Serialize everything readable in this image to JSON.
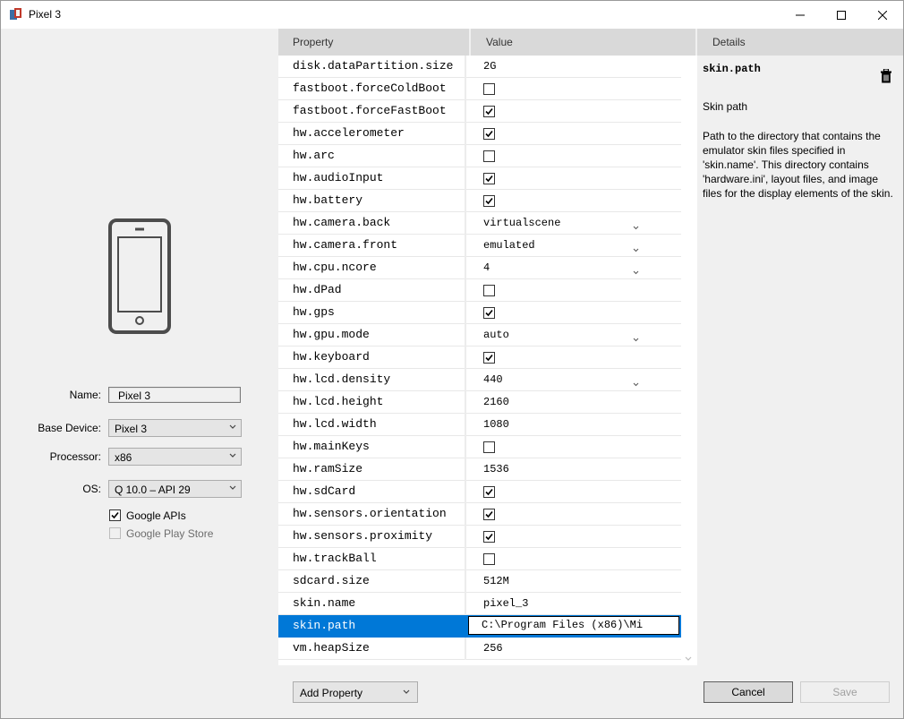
{
  "window": {
    "title": "Pixel 3"
  },
  "form": {
    "name_label": "Name:",
    "name_value": "Pixel 3",
    "base_device_label": "Base Device:",
    "base_device_value": "Pixel 3",
    "processor_label": "Processor:",
    "processor_value": "x86",
    "os_label": "OS:",
    "os_value": "Q 10.0 – API 29",
    "google_apis_label": "Google APIs",
    "google_apis_checked": true,
    "google_play_label": "Google Play Store",
    "google_play_checked": false
  },
  "grid": {
    "header_property": "Property",
    "header_value": "Value",
    "rows": [
      {
        "name": "disk.dataPartition.size",
        "kind": "text",
        "value": "2G"
      },
      {
        "name": "fastboot.forceColdBoot",
        "kind": "check",
        "checked": false
      },
      {
        "name": "fastboot.forceFastBoot",
        "kind": "check",
        "checked": true
      },
      {
        "name": "hw.accelerometer",
        "kind": "check",
        "checked": true
      },
      {
        "name": "hw.arc",
        "kind": "check",
        "checked": false
      },
      {
        "name": "hw.audioInput",
        "kind": "check",
        "checked": true
      },
      {
        "name": "hw.battery",
        "kind": "check",
        "checked": true
      },
      {
        "name": "hw.camera.back",
        "kind": "dropdown",
        "value": "virtualscene"
      },
      {
        "name": "hw.camera.front",
        "kind": "dropdown",
        "value": "emulated"
      },
      {
        "name": "hw.cpu.ncore",
        "kind": "dropdown",
        "value": "4"
      },
      {
        "name": "hw.dPad",
        "kind": "check",
        "checked": false
      },
      {
        "name": "hw.gps",
        "kind": "check",
        "checked": true
      },
      {
        "name": "hw.gpu.mode",
        "kind": "dropdown",
        "value": "auto"
      },
      {
        "name": "hw.keyboard",
        "kind": "check",
        "checked": true
      },
      {
        "name": "hw.lcd.density",
        "kind": "dropdown",
        "value": "440"
      },
      {
        "name": "hw.lcd.height",
        "kind": "text",
        "value": "2160"
      },
      {
        "name": "hw.lcd.width",
        "kind": "text",
        "value": "1080"
      },
      {
        "name": "hw.mainKeys",
        "kind": "check",
        "checked": false
      },
      {
        "name": "hw.ramSize",
        "kind": "text",
        "value": "1536"
      },
      {
        "name": "hw.sdCard",
        "kind": "check",
        "checked": true
      },
      {
        "name": "hw.sensors.orientation",
        "kind": "check",
        "checked": true
      },
      {
        "name": "hw.sensors.proximity",
        "kind": "check",
        "checked": true
      },
      {
        "name": "hw.trackBall",
        "kind": "check",
        "checked": false
      },
      {
        "name": "sdcard.size",
        "kind": "text",
        "value": "512M"
      },
      {
        "name": "skin.name",
        "kind": "text",
        "value": "pixel_3"
      },
      {
        "name": "skin.path",
        "kind": "edit",
        "value": "C:\\Program Files (x86)\\Mi",
        "selected": true
      },
      {
        "name": "vm.heapSize",
        "kind": "text",
        "value": "256"
      }
    ]
  },
  "details": {
    "header": "Details",
    "title": "skin.path",
    "subtitle": "Skin path",
    "description": "Path to the directory that contains the emulator skin files specified in 'skin.name'. This directory contains 'hardware.ini', layout files, and image files for the display elements of the skin."
  },
  "footer": {
    "add_property_label": "Add Property",
    "cancel_label": "Cancel",
    "save_label": "Save"
  },
  "icons": {
    "app": "device-manager-icon",
    "phone": "phone-icon",
    "trash": "trash-icon"
  }
}
